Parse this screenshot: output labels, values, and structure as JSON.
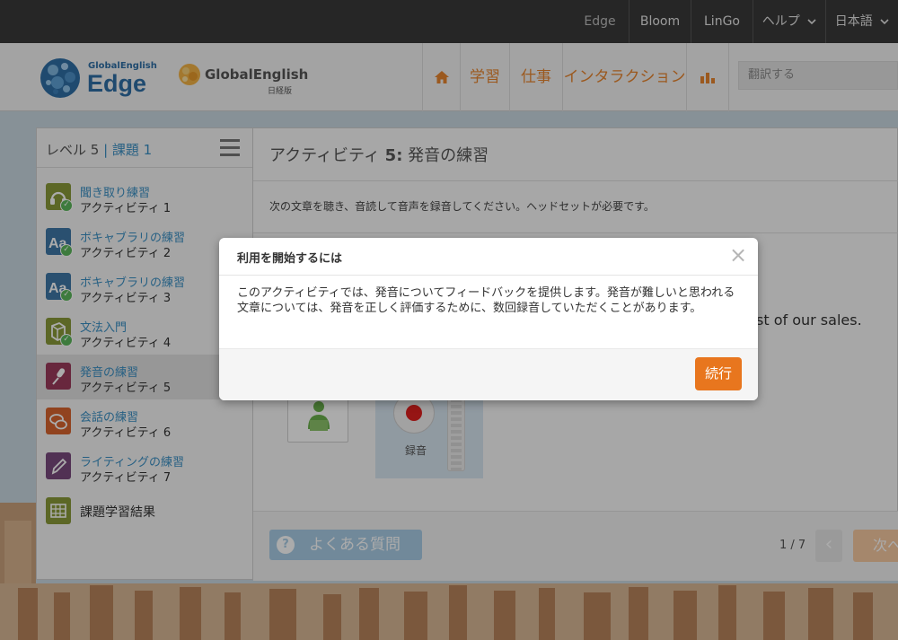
{
  "topbar": {
    "items": [
      "Edge",
      "Bloom",
      "LinGo"
    ],
    "help": "ヘルプ",
    "language": "日本語"
  },
  "header": {
    "logo_small": "GlobalEnglish",
    "logo_edge": "Edge",
    "logo_ge": "GlobalEnglish",
    "logo_ge_sub": "日経版",
    "nav": [
      "学習",
      "仕事",
      "インタラクション"
    ],
    "search_placeholder": "翻訳する"
  },
  "sidebar": {
    "level_label": "レベル 5",
    "separator": " | ",
    "unit_label": "課題 1",
    "items": [
      {
        "title": "聞き取り練習",
        "subtitle": "アクティビティ 1",
        "icon": "headphones-icon",
        "color": "#8a9a3a",
        "completed": true
      },
      {
        "title": "ボキャブラリの練習",
        "subtitle": "アクティビティ 2",
        "icon": "vocabulary-icon",
        "color": "#3f78a8",
        "completed": true
      },
      {
        "title": "ボキャブラリの練習",
        "subtitle": "アクティビティ 3",
        "icon": "vocabulary-icon",
        "color": "#3f78a8",
        "completed": true
      },
      {
        "title": "文法入門",
        "subtitle": "アクティビティ 4",
        "icon": "grammar-icon",
        "color": "#8a9a3a",
        "completed": true
      },
      {
        "title": "発音の練習",
        "subtitle": "アクティビティ 5",
        "icon": "microphone-icon",
        "color": "#9b3b5c",
        "completed": false
      },
      {
        "title": "会話の練習",
        "subtitle": "アクティビティ 6",
        "icon": "conversation-icon",
        "color": "#d8652f",
        "completed": false
      },
      {
        "title": "ライティングの練習",
        "subtitle": "アクティビティ 7",
        "icon": "pencil-icon",
        "color": "#7a4a7e",
        "completed": false
      }
    ],
    "results": "課題学習結果"
  },
  "main": {
    "title_prefix": "アクティビティ ",
    "title_number": "5:",
    "title_name": " 発音の練習",
    "instruction": "次の文章を聴き、音読して音声を録音してください。ヘッドセットが必要です。",
    "sentence_fragment": "st of our sales.",
    "record_label": "録音",
    "faq": "よくある質問",
    "page_indicator": "1 / 7",
    "next_label": "次へ"
  },
  "modal": {
    "title": "利用を開始するには",
    "body": "このアクティビティでは、発音についてフィードバックを提供します。発音が難しいと思われる文章については、発音を正しく評価するために、数回録音していただくことがあります。",
    "continue": "続行"
  },
  "colors": {
    "accent": "#e8761e",
    "nav": "#e8852f",
    "link": "#3a8fc4",
    "faq": "#a9cde6"
  }
}
